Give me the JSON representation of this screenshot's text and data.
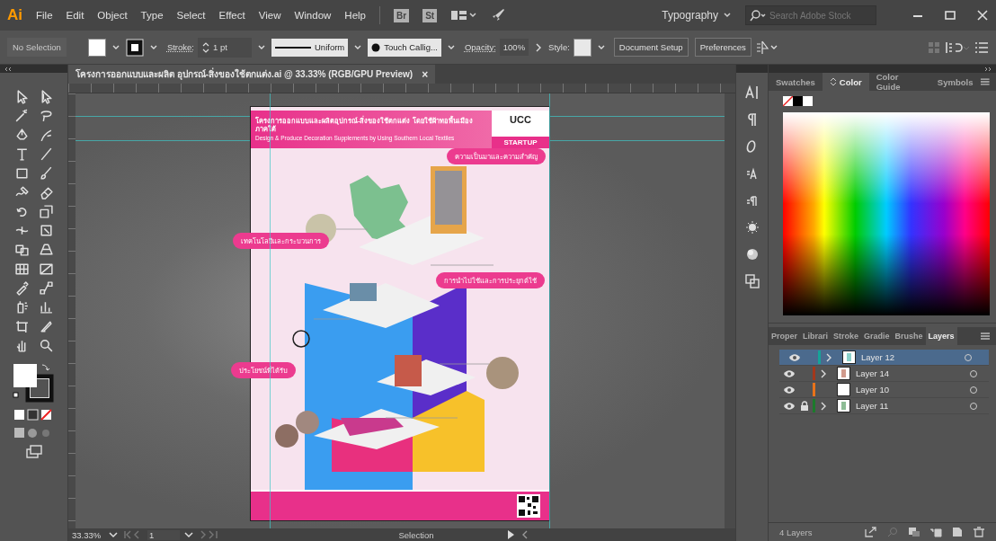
{
  "app": {
    "logo": "Ai"
  },
  "menu": [
    "File",
    "Edit",
    "Object",
    "Type",
    "Select",
    "Effect",
    "View",
    "Window",
    "Help"
  ],
  "bridge_buttons": [
    "Br",
    "St"
  ],
  "workspace": "Typography",
  "search": {
    "placeholder": "Search Adobe Stock"
  },
  "control_bar": {
    "selection": "No Selection",
    "stroke_label": "Stroke:",
    "stroke_weight": "1 pt",
    "profile": "Uniform",
    "brush": "Touch Callig...",
    "opacity_label": "Opacity:",
    "opacity": "100%",
    "style_label": "Style:",
    "buttons": [
      "Document Setup",
      "Preferences"
    ]
  },
  "document_tab": {
    "title": "โครงการออกแบบและผลิต อุปกรณ์-สิ่งของใช้ตกแต่ง.ai @ 33.33% (RGB/GPU Preview)",
    "close": "×"
  },
  "poster": {
    "title": "โครงการออกแบบและผลิตอุปกรณ์-สิ่งของใช้ตกแต่ง โดยใช้ผ้าทอพื้นเมืองภาคใต้",
    "subtitle": "Design & Produce Decoration Supplements by Using Southern Local Textiles",
    "logo": "UCC",
    "badge": "STARTUP",
    "headings": [
      "ความเป็นมาและความสำคัญ",
      "เทคโนโลยีและกระบวนการ",
      "การนำไปใช้และการประยุกต์ใช้",
      "ประโยชน์ที่ได้รับ"
    ]
  },
  "color_panel": {
    "tabs": [
      {
        "label": "Swatches",
        "selected": false
      },
      {
        "label": "Color",
        "selected": true
      },
      {
        "label": "Color Guide",
        "selected": false
      },
      {
        "label": "Symbols",
        "selected": false
      }
    ]
  },
  "layers_panel": {
    "tabs": [
      {
        "label": "Proper",
        "selected": false
      },
      {
        "label": "Librari",
        "selected": false
      },
      {
        "label": "Stroke",
        "selected": false
      },
      {
        "label": "Gradie",
        "selected": false
      },
      {
        "label": "Brushe",
        "selected": false
      },
      {
        "label": "Layers",
        "selected": true
      }
    ],
    "layers": [
      {
        "name": "Layer 12",
        "color": "#17a398",
        "expandable": true,
        "locked": false,
        "selected": true
      },
      {
        "name": "Layer 14",
        "color": "#a3381c",
        "expandable": true,
        "locked": false,
        "selected": false
      },
      {
        "name": "Layer 10",
        "color": "#e8731a",
        "expandable": false,
        "locked": false,
        "selected": false
      },
      {
        "name": "Layer 11",
        "color": "#1c7a2b",
        "expandable": true,
        "locked": true,
        "selected": false
      }
    ],
    "footer": "4 Layers"
  },
  "status_bar": {
    "zoom": "33.33%",
    "artboard": "1",
    "tool": "Selection"
  }
}
